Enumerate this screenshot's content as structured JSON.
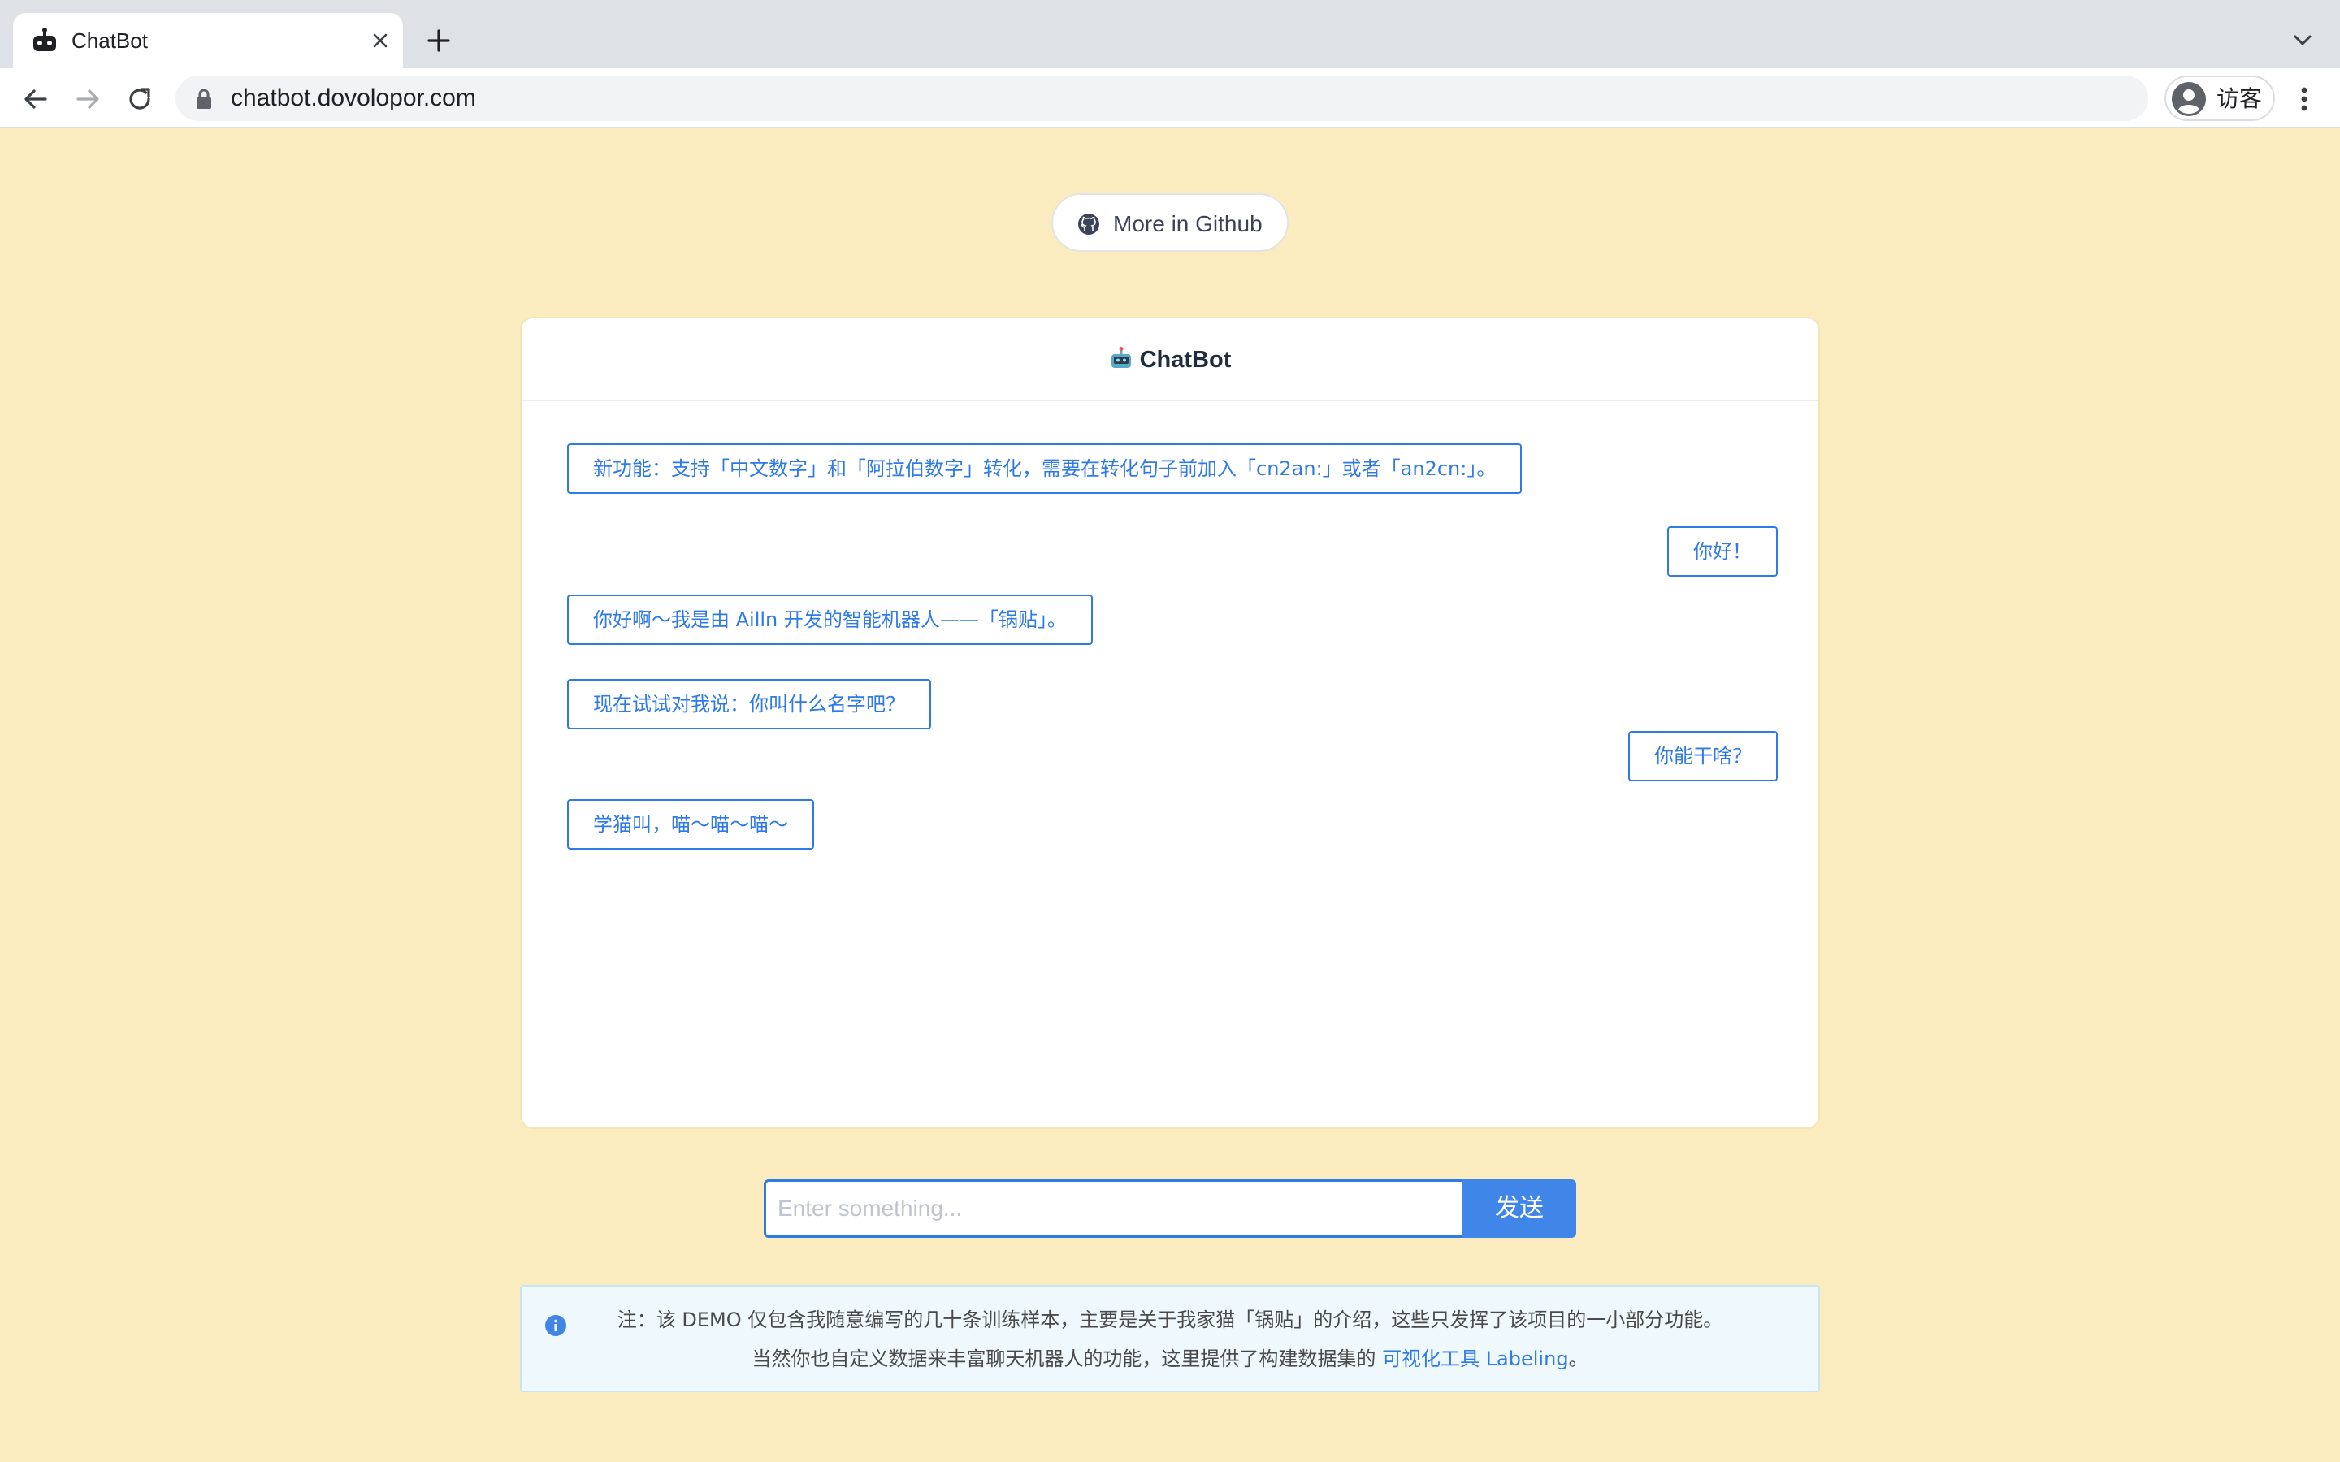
{
  "browser": {
    "tab_title": "ChatBot",
    "url": "chatbot.dovolopor.com",
    "profile_label": "访客"
  },
  "page": {
    "github_button_label": "More in Github",
    "chat": {
      "header_title": "ChatBot",
      "messages": [
        {
          "side": "bot",
          "text": "新功能：支持「中文数字」和「阿拉伯数字」转化，需要在转化句子前加入「cn2an:」或者「an2cn:」。"
        },
        {
          "side": "user",
          "text": "你好！"
        },
        {
          "side": "bot",
          "text": "你好啊～我是由 Ailln 开发的智能机器人——「锅贴」。"
        },
        {
          "side": "bot",
          "text": "现在试试对我说：你叫什么名字吧？"
        },
        {
          "side": "user",
          "text": "你能干啥？"
        },
        {
          "side": "bot",
          "text": "学猫叫，喵～喵～喵～"
        }
      ]
    },
    "input": {
      "placeholder": "Enter something...",
      "value": "",
      "send_label": "发送"
    },
    "notice": {
      "line1": "注：该 DEMO 仅包含我随意编写的几十条训练样本，主要是关于我家猫「锅贴」的介绍，这些只发挥了该项目的一小部分功能。",
      "line2_prefix": "当然你也自定义数据来丰富聊天机器人的功能，这里提供了构建数据集的 ",
      "line2_link": "可视化工具 Labeling",
      "line2_suffix": "。"
    }
  },
  "colors": {
    "page_background": "#fbecc0",
    "accent": "#2e7ae6",
    "send_button": "#3f86e8",
    "notice_background": "#eef8fd"
  },
  "icons": [
    "robot-favicon-icon",
    "close-icon",
    "plus-icon",
    "chevron-down-icon",
    "back-arrow-icon",
    "forward-arrow-icon",
    "reload-icon",
    "lock-icon",
    "profile-avatar-icon",
    "more-vertical-icon",
    "github-icon",
    "robot-emoji-icon",
    "info-icon"
  ]
}
